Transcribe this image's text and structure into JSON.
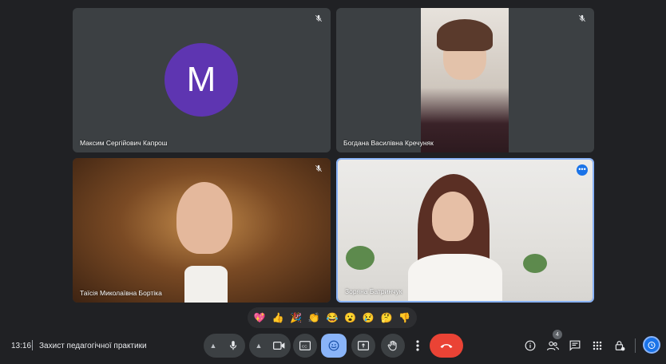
{
  "tiles": [
    {
      "name": "Максим Сергійович Капрош",
      "avatar_letter": "M",
      "avatar_color": "#5e35b1",
      "muted": true
    },
    {
      "name": "Богдана Василівна Кречуняк",
      "muted": true
    },
    {
      "name": "Таїсія Миколаївна Бортіка",
      "muted": true
    },
    {
      "name": "Зоряна Батринчук",
      "muted": false,
      "speaking": true
    }
  ],
  "reactions": [
    "💖",
    "👍",
    "🎉",
    "👏",
    "😂",
    "😮",
    "😢",
    "🤔",
    "👎"
  ],
  "meeting": {
    "time": "13:16",
    "title": "Захист педагогічної практики"
  },
  "controls": {
    "icons": [
      "mic-icon",
      "camera-icon",
      "captions-icon",
      "emoji-icon",
      "present-icon",
      "hand-icon",
      "more-options-icon",
      "end-call-icon"
    ]
  },
  "right_controls": {
    "people_count": "4",
    "icons": [
      "info-icon",
      "people-icon",
      "chat-icon",
      "activities-icon",
      "host-controls-icon"
    ]
  },
  "colors": {
    "background": "#202124",
    "tile": "#3c4043",
    "accent": "#8ab4f8",
    "end": "#ea4335"
  }
}
